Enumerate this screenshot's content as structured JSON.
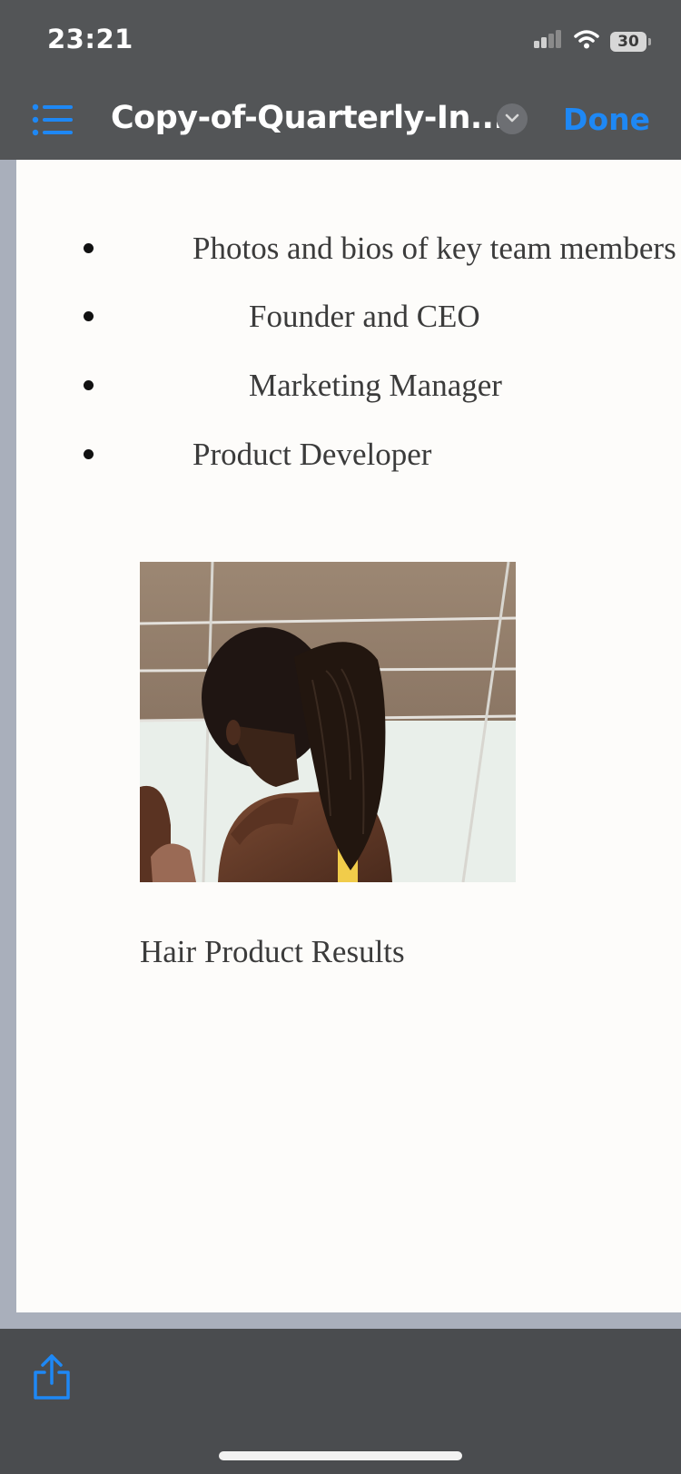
{
  "status_bar": {
    "time": "23:21",
    "battery": "30"
  },
  "nav_bar": {
    "title": "Copy-of-Quarterly-In...",
    "done_label": "Done",
    "accent_color": "#1e88f5"
  },
  "document": {
    "list_items": [
      "Photos and bios of key team members",
      "Founder and CEO",
      "Marketing Manager",
      "Product Developer"
    ],
    "image_caption": "Hair Product Results"
  },
  "icons": {
    "list": "list-icon",
    "chevron": "chevron-down-icon",
    "share": "share-icon",
    "signal": "signal-icon",
    "wifi": "wifi-icon",
    "battery": "battery-icon"
  }
}
